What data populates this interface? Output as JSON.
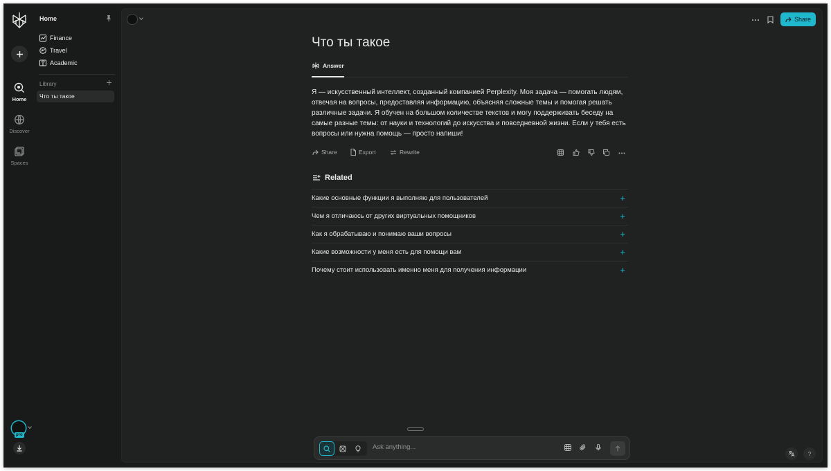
{
  "rail": {
    "items": [
      {
        "label": "Home",
        "icon": "home-search-icon"
      },
      {
        "label": "Discover",
        "icon": "globe-icon"
      },
      {
        "label": "Spaces",
        "icon": "spaces-icon"
      }
    ],
    "pro_badge": "pro"
  },
  "sidebar": {
    "title": "Home",
    "nav": [
      {
        "label": "Finance",
        "icon": "chart-icon"
      },
      {
        "label": "Travel",
        "icon": "plane-icon"
      },
      {
        "label": "Academic",
        "icon": "book-icon"
      }
    ],
    "library_label": "Library",
    "library_items": [
      "Что ты такое"
    ]
  },
  "header": {
    "share_label": "Share"
  },
  "thread": {
    "question": "Что ты такое",
    "tab_answer": "Answer",
    "answer": "Я — искусственный интеллект, созданный компанией Perplexity. Моя задача — помогать людям, отвечая на вопросы, предоставляя информацию, объясняя сложные темы и помогая решать различные задачи. Я обучен на большом количестве текстов и могу поддерживать беседу на самые разные темы: от науки и технологий до искусства и повседневной жизни. Если у тебя есть вопросы или нужна помощь — просто напиши!",
    "actions": {
      "share": "Share",
      "export": "Export",
      "rewrite": "Rewrite"
    },
    "related_title": "Related",
    "related": [
      "Какие основные функции я выполняю для пользователей",
      "Чем я отличаюсь от других виртуальных помощников",
      "Как я обрабатываю и понимаю ваши вопросы",
      "Какие возможности у меня есть для помощи вам",
      "Почему стоит использовать именно меня для получения информации"
    ]
  },
  "input": {
    "placeholder": "Ask anything..."
  },
  "footer": {
    "help_label": "?"
  },
  "colors": {
    "accent": "#20b8cd",
    "background": "#191a1a",
    "panel": "#202222"
  }
}
